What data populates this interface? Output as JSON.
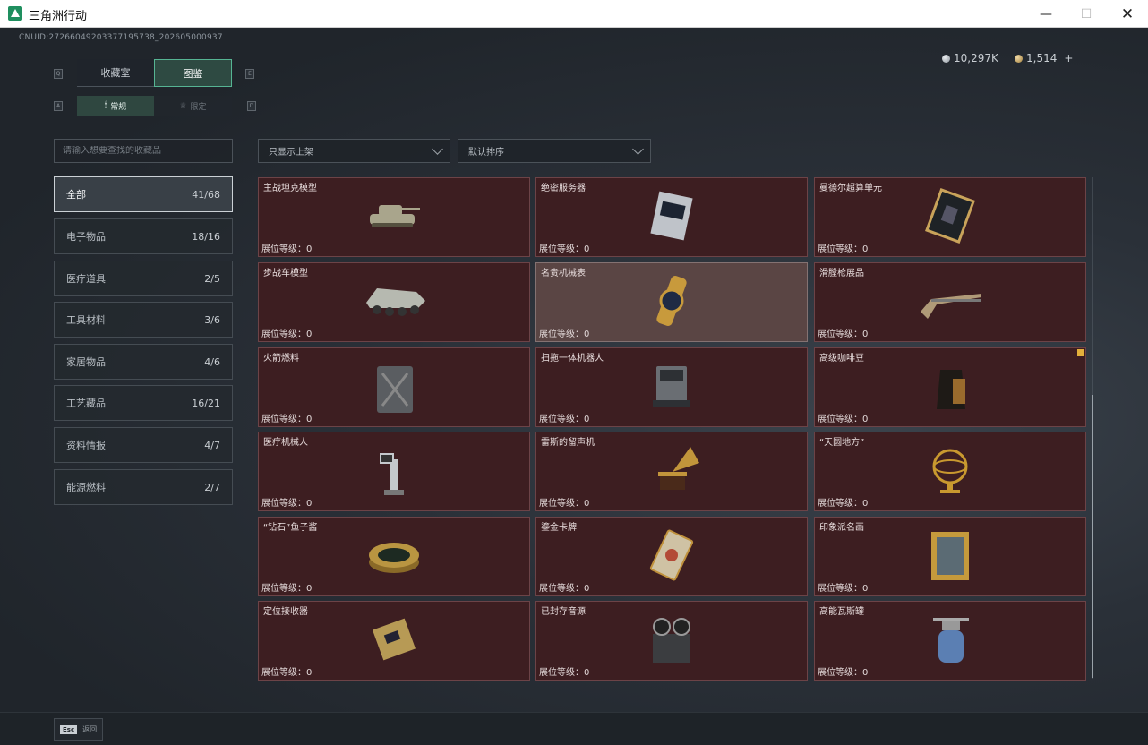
{
  "window": {
    "title": "三角洲行动",
    "min_glyph": "—",
    "max_glyph": "☐",
    "close_glyph": "✕"
  },
  "header": {
    "uid": "CNUID:272660492033771957​38_202605000937",
    "currency_silver": "10,297K",
    "currency_gold": "1,514",
    "plus": "+"
  },
  "tabs": {
    "key_left": "Q",
    "key_right": "E",
    "main": [
      "收藏室",
      "图鉴"
    ],
    "key_sub_left": "A",
    "key_sub_right": "D",
    "sub": [
      "常规",
      "限定"
    ],
    "sub_icons": [
      "flame-icon",
      "crown-icon"
    ]
  },
  "filters": {
    "search_placeholder": "请输入想要查找的收藏品",
    "shelf_filter": "只显示上架",
    "sort": "默认排序"
  },
  "categories": [
    {
      "label": "全部",
      "count": "41/68",
      "active": true
    },
    {
      "label": "电子物品",
      "count": "18/16",
      "active": false
    },
    {
      "label": "医疗道具",
      "count": "2/5",
      "active": false
    },
    {
      "label": "工具材料",
      "count": "3/6",
      "active": false
    },
    {
      "label": "家居物品",
      "count": "4/6",
      "active": false
    },
    {
      "label": "工艺藏品",
      "count": "16/21",
      "active": false
    },
    {
      "label": "资料情报",
      "count": "4/7",
      "active": false
    },
    {
      "label": "能源燃料",
      "count": "2/7",
      "active": false
    }
  ],
  "items": [
    {
      "name": "主战坦克模型",
      "level": "展位等级：0",
      "icon": "tank-icon",
      "color": "#a9a58c"
    },
    {
      "name": "绝密服务器",
      "level": "展位等级：0",
      "icon": "server-icon",
      "color": "#bfc3c9"
    },
    {
      "name": "曼德尔超算单元",
      "level": "展位等级：0",
      "icon": "supercomputer-icon",
      "color": "#c9a35a"
    },
    {
      "name": "步战车模型",
      "level": "展位等级：0",
      "icon": "apc-icon",
      "color": "#b6b9b0"
    },
    {
      "name": "名贵机械表",
      "level": "展位等级：0",
      "icon": "watch-icon",
      "color": "#c89a3c"
    },
    {
      "name": "滑膛枪展品",
      "level": "展位等级：0",
      "icon": "musket-icon",
      "color": "#b09a78"
    },
    {
      "name": "火箭燃料",
      "level": "展位等级：0",
      "icon": "jerrycan-icon",
      "color": "#5a5d61"
    },
    {
      "name": "扫拖一体机器人",
      "level": "展位等级：0",
      "icon": "robot-vacuum-icon",
      "color": "#6a6e73"
    },
    {
      "name": "高级咖啡豆",
      "level": "展位等级：0",
      "icon": "coffee-bag-icon",
      "color": "#9a6b2d"
    },
    {
      "name": "医疗机械人",
      "level": "展位等级：0",
      "icon": "medical-robot-icon",
      "color": "#c4c8cc"
    },
    {
      "name": "雷斯的留声机",
      "level": "展位等级：0",
      "icon": "gramophone-icon",
      "color": "#c2953b"
    },
    {
      "name": "“天圆地方”",
      "level": "展位等级：0",
      "icon": "armillary-sphere-icon",
      "color": "#c9992f"
    },
    {
      "name": "“钻石”鱼子酱",
      "level": "展位等级：0",
      "icon": "caviar-tin-icon",
      "color": "#b99541"
    },
    {
      "name": "鎏金卡牌",
      "level": "展位等级：0",
      "icon": "gold-card-icon",
      "color": "#cfc2a4"
    },
    {
      "name": "印象派名画",
      "level": "展位等级：0",
      "icon": "painting-icon",
      "color": "#c59a3c"
    },
    {
      "name": "定位接收器",
      "level": "展位等级：0",
      "icon": "gps-receiver-icon",
      "color": "#b79a55"
    },
    {
      "name": "已封存音源",
      "level": "展位等级：0",
      "icon": "reel-recorder-icon",
      "color": "#3b3d40"
    },
    {
      "name": "高能瓦斯罐",
      "level": "展位等级：0",
      "icon": "gas-canister-icon",
      "color": "#5b7fb3"
    }
  ],
  "footer": {
    "esc_key": "Esc",
    "esc_label": "返回"
  }
}
